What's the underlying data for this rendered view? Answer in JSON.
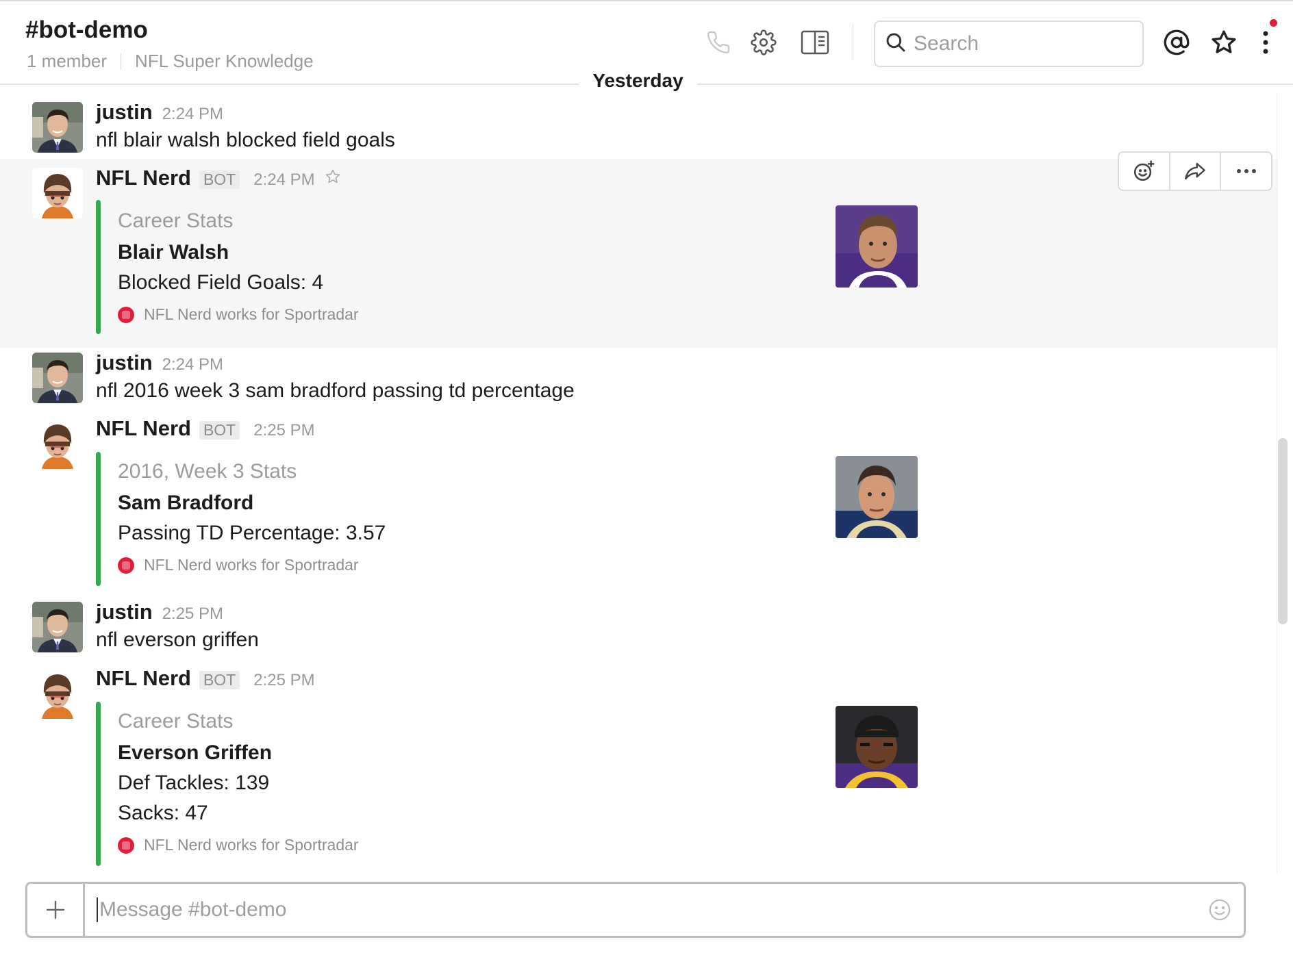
{
  "header": {
    "channel_name": "#bot-demo",
    "member_count": "1 member",
    "topic": "NFL Super Knowledge",
    "search_placeholder": "Search",
    "icons": [
      "phone-icon",
      "gear-icon",
      "details-pane-icon",
      "search-icon",
      "mention-icon",
      "star-icon",
      "more-vertical-icon"
    ]
  },
  "day_divider": "Yesterday",
  "colors": {
    "attachment_bar": "#36a64f",
    "notification_dot": "#e01e3c",
    "footer_icon": "#e01e3c"
  },
  "messages": [
    {
      "author": "justin",
      "time": "2:24 PM",
      "text": "nfl blair walsh blocked field goals"
    },
    {
      "author": "NFL Nerd",
      "badge": "BOT",
      "time": "2:24 PM",
      "attachment": {
        "pretext": "Career Stats",
        "title": "Blair Walsh",
        "fields": [
          "Blocked Field Goals: 4"
        ],
        "footer": "NFL Nerd works for Sportradar"
      }
    },
    {
      "author": "justin",
      "time": "2:24 PM",
      "text": "nfl 2016 week 3 sam bradford passing td percentage"
    },
    {
      "author": "NFL Nerd",
      "badge": "BOT",
      "time": "2:25 PM",
      "attachment": {
        "pretext": "2016, Week 3 Stats",
        "title": "Sam Bradford",
        "fields": [
          "Passing TD Percentage: 3.57"
        ],
        "footer": "NFL Nerd works for Sportradar"
      }
    },
    {
      "author": "justin",
      "time": "2:25 PM",
      "text": "nfl everson griffen"
    },
    {
      "author": "NFL Nerd",
      "badge": "BOT",
      "time": "2:25 PM",
      "attachment": {
        "pretext": "Career Stats",
        "title": "Everson Griffen",
        "fields": [
          "Def Tackles: 139",
          "Sacks: 47"
        ],
        "footer": "NFL Nerd works for Sportradar"
      }
    }
  ],
  "message_actions": [
    "add-reaction-icon",
    "share-icon",
    "more-horizontal-icon"
  ],
  "composer": {
    "placeholder": "Message #bot-demo"
  }
}
